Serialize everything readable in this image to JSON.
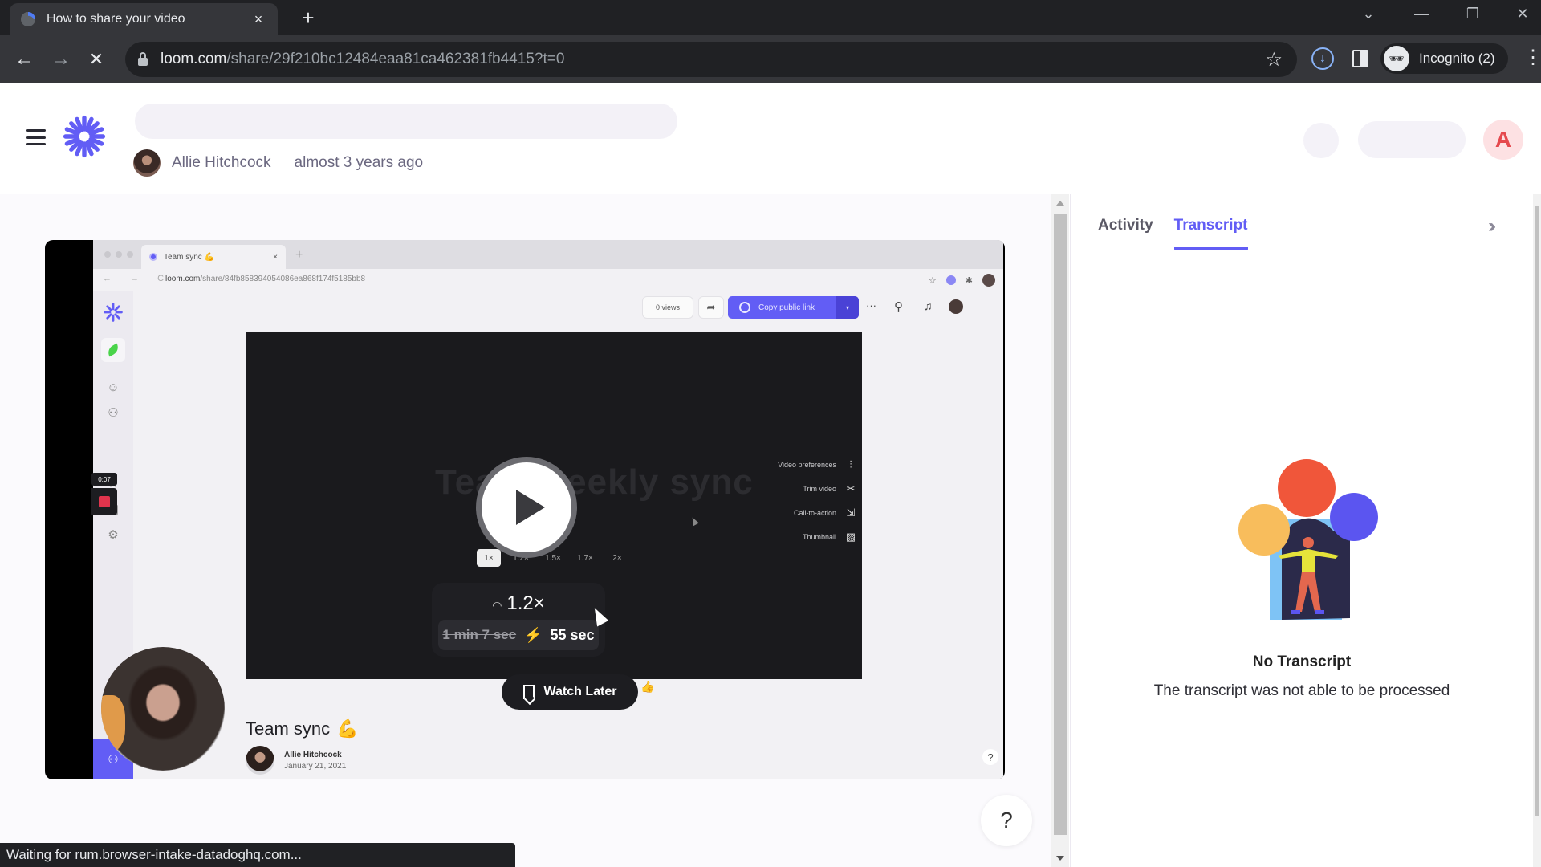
{
  "browser": {
    "tab_title": "How to share your video",
    "tab_close": "×",
    "new_tab": "+",
    "url_host": "loom.com",
    "url_path": "/share/29f210bc12484eaa81ca462381fb4415?t=0",
    "profile_label": "Incognito (2)",
    "status_text": "Waiting for rum.browser-intake-datadoghq.com...",
    "icons": {
      "back": "←",
      "forward": "→",
      "stop": "✕",
      "star": "☆",
      "download": "↓",
      "menu": "⋮",
      "tab_search": "⌄",
      "minimize": "—",
      "restore": "❐",
      "close": "✕",
      "incognito": "🕶"
    }
  },
  "header": {
    "author_name": "Allie Hitchcock",
    "posted_time": "almost 3 years ago",
    "user_initial": "A"
  },
  "video": {
    "inner_tab_title": "Team sync 💪",
    "inner_tab_close": "×",
    "inner_new_tab": "+",
    "inner_nav": "← → C",
    "inner_url_host": "loom.com",
    "inner_url_path": "/share/84fb858394054086ea868f174f5185bb8",
    "views_label": "0 views",
    "share_icon": "➦",
    "copy_link_label": "Copy public link",
    "copy_link_dropdown": "▾",
    "more_icon": "···",
    "search_icon": "⚲",
    "bell_icon": "🔔",
    "ghost_title": "Team weekly sync",
    "speed_options": [
      {
        "label": "1×",
        "selected": true
      },
      {
        "label": "1.2×",
        "selected": false
      },
      {
        "label": "1.5×",
        "selected": false
      },
      {
        "label": "1.7×",
        "selected": false
      },
      {
        "label": "2×",
        "selected": false
      }
    ],
    "speed_current": "1.2×",
    "speed_gauge_icon": "◠",
    "original_duration": "1 min 7 sec",
    "bolt_icon": "⚡",
    "new_duration": "55 sec",
    "side_menu": [
      {
        "label": "Video preferences",
        "icon": "⫶"
      },
      {
        "label": "Trim video",
        "icon": "✂"
      },
      {
        "label": "Call-to-action",
        "icon": "⇲"
      },
      {
        "label": "Thumbnail",
        "icon": "▨"
      }
    ],
    "recording_timer": "0:07",
    "watch_later_label": "Watch Later",
    "thumb_emoji": "👍",
    "video_title": "Team sync",
    "title_emoji": "💪",
    "video_author": "Allie Hitchcock",
    "video_date": "January 21, 2021",
    "inner_help": "?",
    "sidebar_icons": [
      "☺",
      "⚇",
      "☆",
      "▤",
      "⚙"
    ]
  },
  "help_button": "?",
  "panel": {
    "tabs": [
      {
        "label": "Activity",
        "active": false
      },
      {
        "label": "Transcript",
        "active": true
      }
    ],
    "collapse_icon": "»",
    "empty_title": "No Transcript",
    "empty_subtitle": "The transcript was not able to be processed",
    "illustration_colors": {
      "orange": "#f0563a",
      "yellow": "#f8bd5c",
      "purple": "#5b55f0",
      "sky": "#7ec3f5",
      "navy": "#2b2a4a"
    }
  },
  "colors": {
    "brand": "#625df5",
    "avatar_bg": "#fde1e3",
    "avatar_fg": "#e5484d"
  }
}
